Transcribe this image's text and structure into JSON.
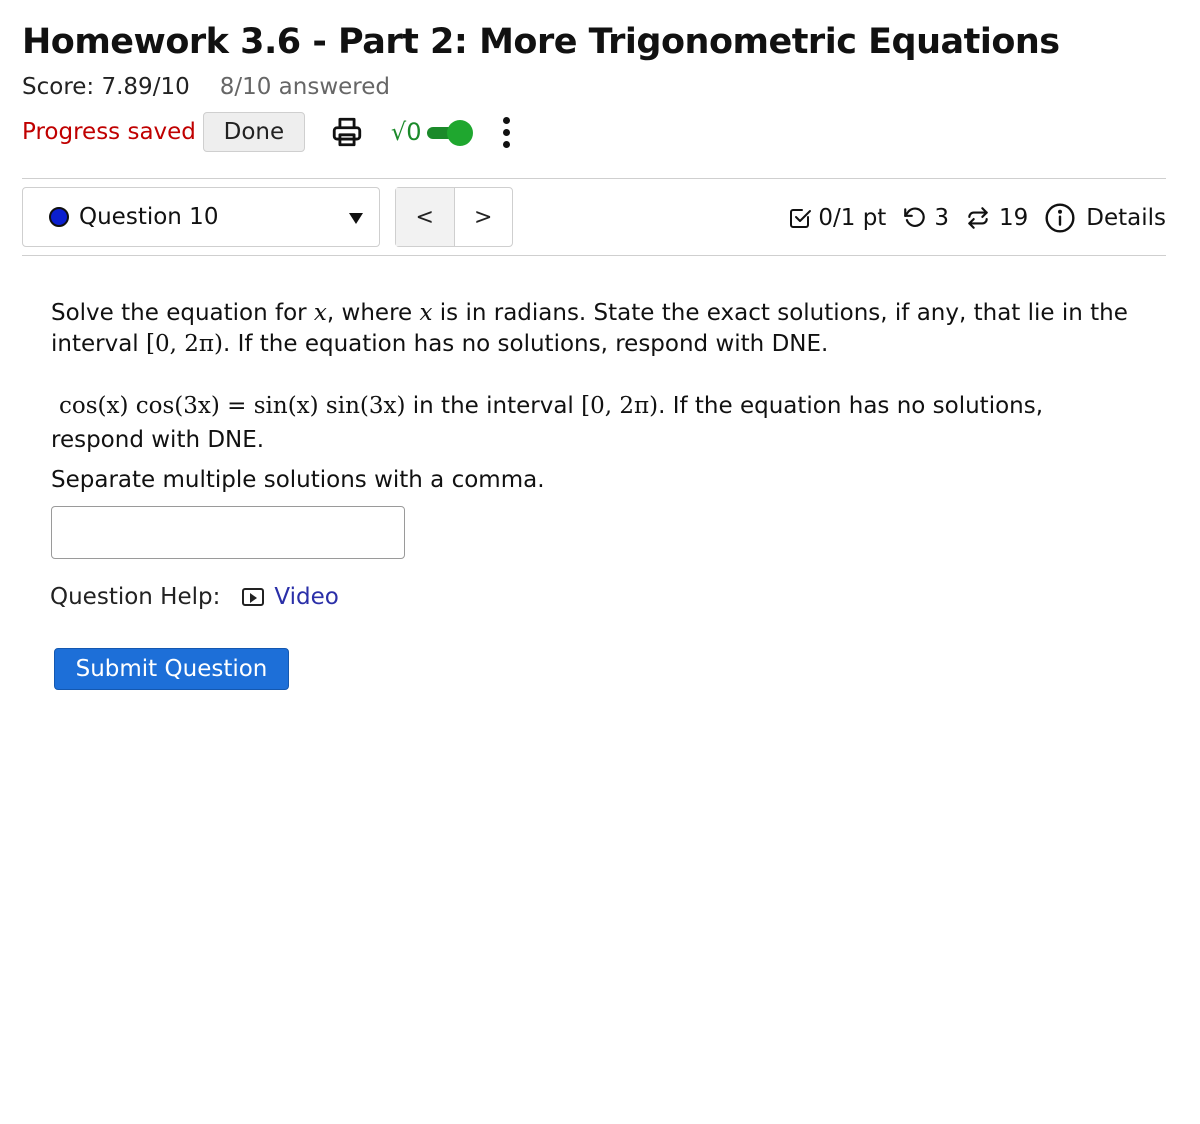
{
  "header": {
    "title": "Homework 3.6 - Part 2: More Trigonometric Equations",
    "score": "Score: 7.89/10",
    "answered": "8/10 answered",
    "progress_status": "Progress saved",
    "done_label": "Done",
    "math_toggle_label": "√0",
    "math_toggle_on": true
  },
  "question_nav": {
    "current": "Question 10",
    "prev_symbol": "<",
    "next_symbol": ">"
  },
  "question_meta": {
    "points": "0/1 pt",
    "attempts": "3",
    "versions": "19",
    "details_label": "Details"
  },
  "question": {
    "p1_a": "Solve the equation for ",
    "p1_x1": "x",
    "p1_b": ", where ",
    "p1_x2": "x",
    "p1_c": " is in radians. State the exact solutions, if any, that lie in the interval ",
    "p1_interval": "[0, 2π)",
    "p1_d": ". If the equation has no solutions, respond with DNE.",
    "equation": "cos(x) cos(3x) = sin(x) sin(3x)",
    "p2_a": " in the interval ",
    "p2_interval": "[0, 2π)",
    "p2_b": ". If the equation has no solutions, respond with DNE.",
    "instructions": "Separate multiple solutions with a comma.",
    "answer_value": ""
  },
  "help": {
    "label": "Question Help:",
    "video_label": "Video"
  },
  "submit_label": "Submit Question",
  "colors": {
    "progress_saved": "#c00000",
    "submit_bg": "#1d6fd8",
    "toggle_green": "#1fa72f",
    "question_dot": "#0b1fcf",
    "link": "#2a2fa8"
  }
}
